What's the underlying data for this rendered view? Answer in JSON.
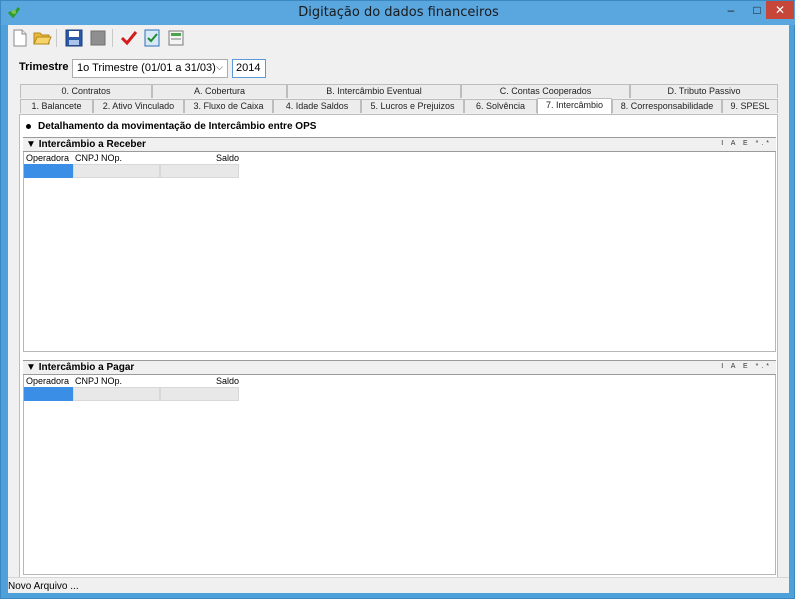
{
  "window": {
    "title": "Digitação do dados financeiros",
    "minimize": "–",
    "maximize": "□",
    "close": "✕"
  },
  "toolbar": {
    "buttons": [
      "new-document-icon",
      "open-folder-icon",
      "save-icon",
      "disabled-save-icon",
      "checkmark-icon",
      "validate-icon",
      "export-icon"
    ]
  },
  "trimestre": {
    "label": "Trimestre",
    "selected": "1o Trimestre (01/01 a 31/03)",
    "year": "2014"
  },
  "tabs_row1": [
    "0. Contratos",
    "A. Cobertura",
    "B. Intercâmbio Eventual",
    "C. Contas Cooperados",
    "D. Tributo Passivo"
  ],
  "tabs_row2": [
    "1. Balancete",
    "2. Ativo Vinculado",
    "3. Fluxo de Caixa",
    "4. Idade Saldos",
    "5. Lucros e Prejuizos",
    "6. Solvência",
    "7. Intercâmbio",
    "8. Corresponsabilidade",
    "9. SPESL"
  ],
  "active_tab": "7. Intercâmbio",
  "section": {
    "title": "Detalhamento da movimentação de Intercâmbio entre OPS"
  },
  "grid_receber": {
    "title": "Intercâmbio a Receber",
    "tools": "I A E *.*",
    "columns": [
      "Operadora",
      "CNPJ NOp.",
      "Saldo"
    ]
  },
  "grid_pagar": {
    "title": "Intercâmbio a Pagar",
    "tools": "I A E *.*",
    "columns": [
      "Operadora",
      "CNPJ NOp.",
      "Saldo"
    ]
  },
  "status": {
    "text": "Novo Arquivo ..."
  }
}
